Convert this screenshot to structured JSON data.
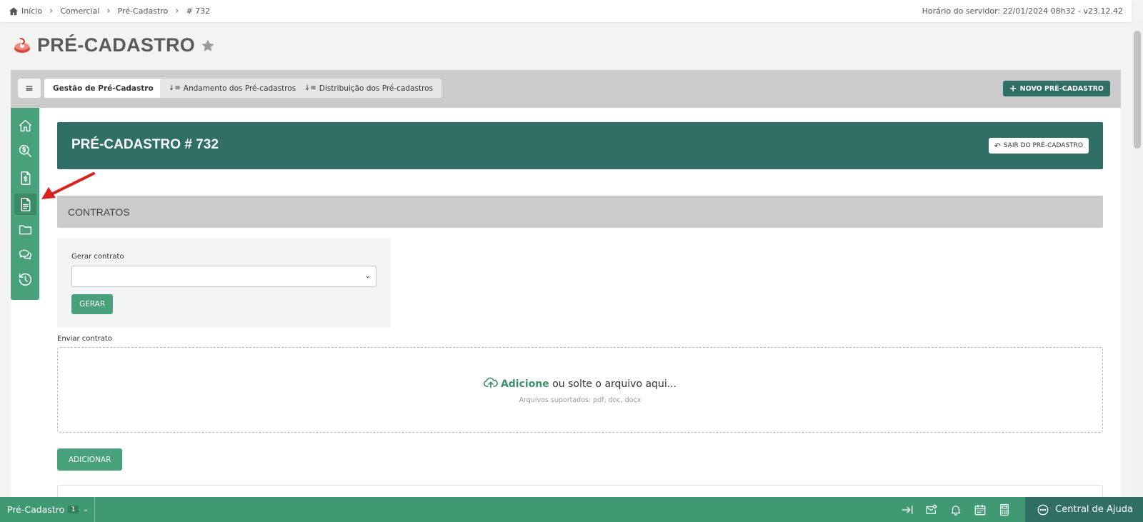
{
  "breadcrumb": {
    "items": [
      "Início",
      "Comercial",
      "Pré-Cadastro",
      "# 732"
    ]
  },
  "server_time": "Horário do servidor: 22/01/2024 08h32 - v23.12.42",
  "page": {
    "title": "PRÉ-CADASTRO"
  },
  "tabs": {
    "menu_label": "≡",
    "items": [
      {
        "label": "Gestão de Pré-Cadastro"
      },
      {
        "label": "Andamento dos Pré-cadastros"
      },
      {
        "label": "Distribuição dos Pré-cadastros"
      }
    ],
    "new_button": "NOVO PRÉ-CADASTRO"
  },
  "sidebar": {
    "items": [
      {
        "icon": "home-icon"
      },
      {
        "icon": "search-money-icon"
      },
      {
        "icon": "invoice-icon"
      },
      {
        "icon": "document-icon",
        "active": true
      },
      {
        "icon": "folder-icon"
      },
      {
        "icon": "chat-icon"
      },
      {
        "icon": "history-icon"
      }
    ]
  },
  "record": {
    "title": "PRÉ-CADASTRO # 732",
    "exit_button": "SAIR DO PRÉ-CADASTRO"
  },
  "section": {
    "title": "CONTRATOS"
  },
  "generate": {
    "label": "Gerar contrato",
    "select_value": "",
    "button": "GERAR"
  },
  "upload": {
    "label": "Enviar contrato",
    "add_text": "Adicione",
    "drop_text": " ou solte o arquivo aqui...",
    "supported": "Arquivos suportados: pdf, doc, docx",
    "add_button": "ADICIONAR"
  },
  "bottombar": {
    "module": "Pré-Cadastro",
    "count": "1",
    "help": "Central de Ajuda"
  },
  "colors": {
    "accent_dark": "#2f6f66",
    "accent": "#48a17a",
    "bottombar": "#3f9a73",
    "annotation_arrow": "#d9231c"
  }
}
